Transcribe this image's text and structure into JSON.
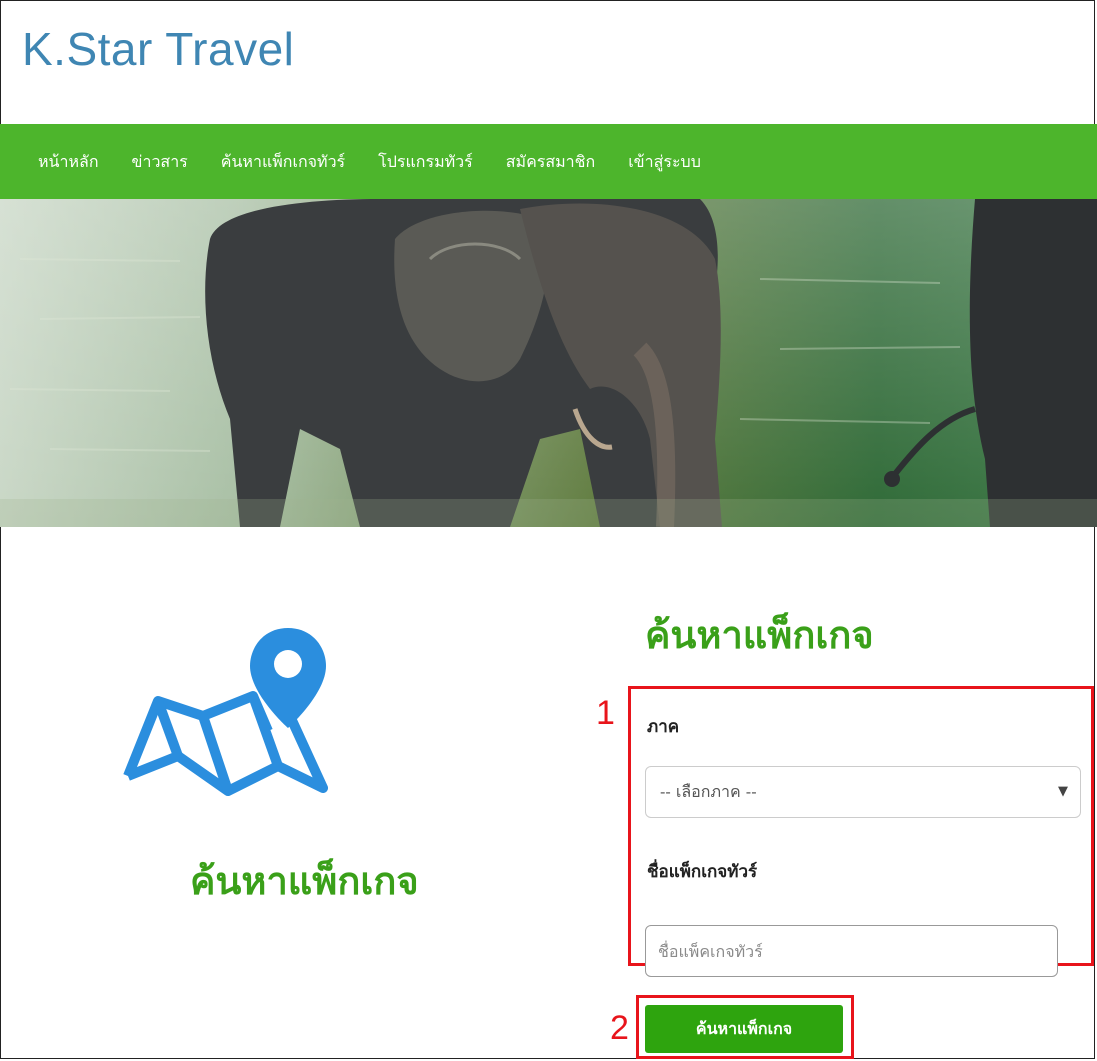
{
  "brand": {
    "title": "K.Star Travel"
  },
  "nav": {
    "items": [
      {
        "label": "หน้าหลัก"
      },
      {
        "label": "ข่าวสาร"
      },
      {
        "label": "ค้นหาแพ็กเกจทัวร์"
      },
      {
        "label": "โปรแกรมทัวร์"
      },
      {
        "label": "สมัครสมาชิก"
      },
      {
        "label": "เข้าสู่ระบบ"
      }
    ]
  },
  "hero": {
    "image": "elephants-in-river"
  },
  "left_panel": {
    "icon": "map-pin-icon",
    "title": "ค้นหาแพ็กเกจ"
  },
  "form": {
    "title": "ค้นหาแพ็กเกจ",
    "region_label": "ภาค",
    "region_select_value": "-- เลือกภาค --",
    "package_label": "ชื่อแพ็กเกจทัวร์",
    "package_placeholder": "ชื่อแพ็คเกจทัวร์",
    "package_value": "",
    "submit_label": "ค้นหาแพ็กเกจ"
  },
  "annotations": {
    "one": "1",
    "two": "2"
  },
  "colors": {
    "nav_bg": "#4db52c",
    "brand": "#3f86b3",
    "accent_green": "#3aa019",
    "annotation": "#e8141b",
    "icon_blue": "#2b8ede"
  }
}
